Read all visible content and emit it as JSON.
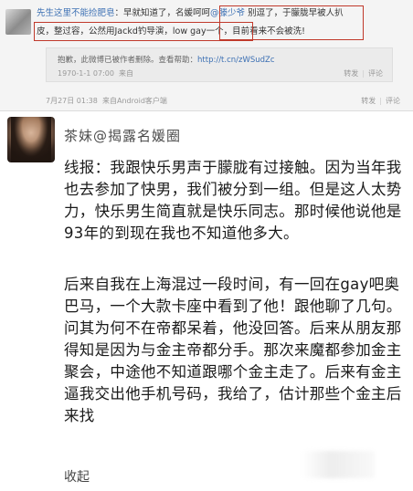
{
  "repost": {
    "author": "先生这里不能捡肥皂",
    "line1_text": "：早就知道了，名媛呵呵",
    "mention": "@滕少爷",
    "line1_tail": " 别逗了，于朦胧早被人扒",
    "line2_text": "皮，整过容，公然用Jackd钓导演，low gay一个，目前看来不会被洗!"
  },
  "quoted": {
    "text": "抱歉，此微博已被作者删除。查看帮助：",
    "link": "http://t.cn/zWSudZc",
    "time": "1970-1-1 07:00",
    "source": "来自",
    "actions": [
      "转发",
      "评论"
    ]
  },
  "meta": {
    "time": "7月27日 01:38",
    "source": "来自Android客户端",
    "actions": [
      "转发",
      "评论"
    ]
  },
  "post": {
    "username": "茶妹@揭露名媛圈",
    "para1": "线报：我跟快乐男声于朦胧有过接触。因为当年我也去参加了快男，我们被分到一组。但是这人太势力，快乐男生简直就是快乐同志。那时候他说他是93年的到现在我也不知道他多大。",
    "para2": "后来自我在上海混过一段时间，有一回在gay吧奥巴马，一个大款卡座中看到了他！跟他聊了几句。问其为何不在帝都呆着，他没回答。后来从朋友那得知是因为与金主帝都分手。那次来魔都参加金主聚会，中途他不知道跟哪个金主走了。后来有金主逼我交出他手机号码，我给了，估计那些个金主后来找",
    "collapse_label": "收起"
  }
}
